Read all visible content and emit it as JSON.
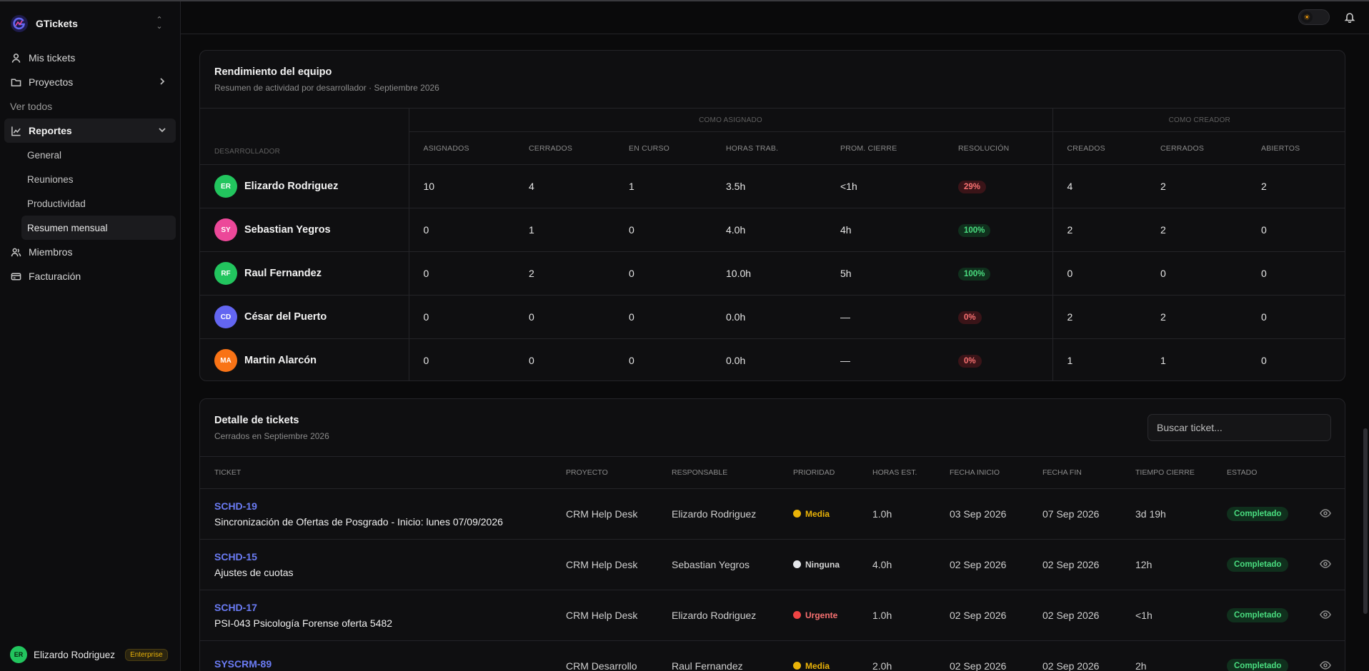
{
  "app": {
    "name": "GTickets",
    "brand_color": "#4f46e5"
  },
  "sidebar": {
    "items": [
      {
        "label": "Mis tickets",
        "icon": "user-icon"
      },
      {
        "label": "Proyectos",
        "icon": "folder-icon"
      },
      {
        "label": "Ver todos"
      },
      {
        "label": "Reportes",
        "icon": "chart-icon"
      },
      {
        "label": "Miembros",
        "icon": "users-icon"
      },
      {
        "label": "Facturación",
        "icon": "card-icon"
      }
    ],
    "reportes_sub": [
      "General",
      "Reuniones",
      "Productividad",
      "Resumen mensual"
    ],
    "user": {
      "initials": "ER",
      "name": "Elizardo Rodriguez",
      "plan": "Enterprise"
    }
  },
  "team": {
    "title": "Rendimiento del equipo",
    "subtitle": "Resumen de actividad por desarrollador · Septiembre 2026",
    "group_assigned": "Como asignado",
    "group_creator": "Como creador",
    "columns": [
      "Desarrollador",
      "Asignados",
      "Cerrados",
      "En curso",
      "Horas trab.",
      "Prom. cierre",
      "Resolución",
      "Creados",
      "Cerrados",
      "Abiertos"
    ],
    "rows": [
      {
        "initials": "ER",
        "color": "#22c55e",
        "name": "Elizardo Rodriguez",
        "asignados": "10",
        "cerrados": "4",
        "en_curso": "1",
        "horas": "3.5h",
        "prom": "<1h",
        "resolucion": "29%",
        "res_ok": false,
        "creados": "4",
        "c_cerrados": "2",
        "abiertos": "2"
      },
      {
        "initials": "SY",
        "color": "#ec4899",
        "name": "Sebastian Yegros",
        "asignados": "0",
        "cerrados": "1",
        "en_curso": "0",
        "horas": "4.0h",
        "prom": "4h",
        "resolucion": "100%",
        "res_ok": true,
        "creados": "2",
        "c_cerrados": "2",
        "abiertos": "0"
      },
      {
        "initials": "RF",
        "color": "#22c55e",
        "name": "Raul Fernandez",
        "asignados": "0",
        "cerrados": "2",
        "en_curso": "0",
        "horas": "10.0h",
        "prom": "5h",
        "resolucion": "100%",
        "res_ok": true,
        "creados": "0",
        "c_cerrados": "0",
        "abiertos": "0"
      },
      {
        "initials": "CD",
        "color": "#6366f1",
        "name": "César del Puerto",
        "asignados": "0",
        "cerrados": "0",
        "en_curso": "0",
        "horas": "0.0h",
        "prom": "—",
        "resolucion": "0%",
        "res_ok": false,
        "creados": "2",
        "c_cerrados": "2",
        "abiertos": "0"
      },
      {
        "initials": "MA",
        "color": "#f97316",
        "name": "Martin Alarcón",
        "asignados": "0",
        "cerrados": "0",
        "en_curso": "0",
        "horas": "0.0h",
        "prom": "—",
        "resolucion": "0%",
        "res_ok": false,
        "creados": "1",
        "c_cerrados": "1",
        "abiertos": "0"
      }
    ]
  },
  "tickets": {
    "title": "Detalle de tickets",
    "subtitle": "Cerrados en Septiembre 2026",
    "search_placeholder": "Buscar ticket...",
    "columns": [
      "Ticket",
      "Proyecto",
      "Responsable",
      "Prioridad",
      "Horas est.",
      "Fecha inicio",
      "Fecha fin",
      "Tiempo cierre",
      "Estado"
    ],
    "rows": [
      {
        "id": "SCHD-19",
        "title": "Sincronización de Ofertas de Posgrado - Inicio: lunes 07/09/2026",
        "proyecto": "CRM Help Desk",
        "responsable": "Elizardo Rodriguez",
        "prioridad": "Media",
        "prio_color": "#eab308",
        "prio_text": "#eab308",
        "horas": "1.0h",
        "inicio": "03 Sep 2026",
        "fin": "07 Sep 2026",
        "cierre": "3d 19h",
        "estado": "Completado"
      },
      {
        "id": "SCHD-15",
        "title": "Ajustes de cuotas",
        "proyecto": "CRM Help Desk",
        "responsable": "Sebastian Yegros",
        "prioridad": "Ninguna",
        "prio_color": "#e5e7eb",
        "prio_text": "#d4d4d4",
        "horas": "4.0h",
        "inicio": "02 Sep 2026",
        "fin": "02 Sep 2026",
        "cierre": "12h",
        "estado": "Completado"
      },
      {
        "id": "SCHD-17",
        "title": "PSI-043 Psicología Forense oferta 5482",
        "proyecto": "CRM Help Desk",
        "responsable": "Elizardo Rodriguez",
        "prioridad": "Urgente",
        "prio_color": "#ef4444",
        "prio_text": "#f87171",
        "horas": "1.0h",
        "inicio": "02 Sep 2026",
        "fin": "02 Sep 2026",
        "cierre": "<1h",
        "estado": "Completado"
      },
      {
        "id": "SYSCRM-89",
        "title": "",
        "proyecto": "CRM Desarrollo",
        "responsable": "Raul Fernandez",
        "prioridad": "Media",
        "prio_color": "#eab308",
        "prio_text": "#eab308",
        "horas": "2.0h",
        "inicio": "02 Sep 2026",
        "fin": "02 Sep 2026",
        "cierre": "2h",
        "estado": "Completado"
      }
    ]
  }
}
